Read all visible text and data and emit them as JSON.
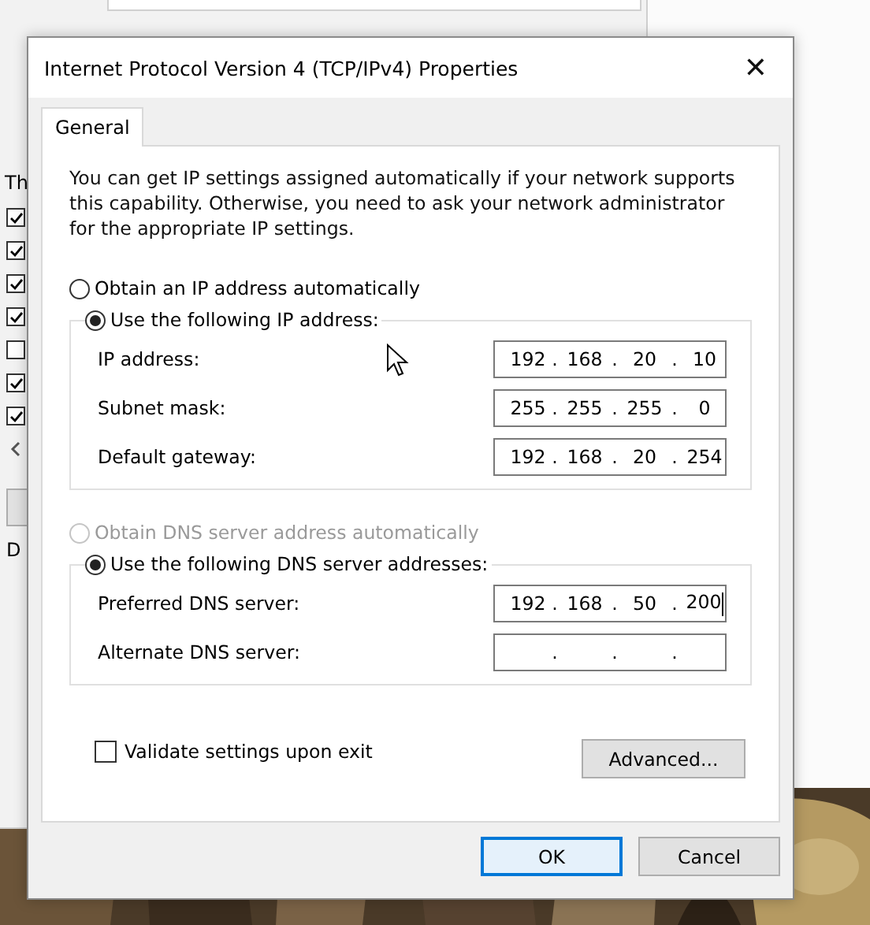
{
  "background_window": {
    "label": "Th",
    "label_2": "D",
    "items": [
      {
        "checked": true
      },
      {
        "checked": true
      },
      {
        "checked": true
      },
      {
        "checked": true
      },
      {
        "checked": false
      },
      {
        "checked": true
      },
      {
        "checked": true
      }
    ]
  },
  "window": {
    "title": "Internet Protocol Version 4 (TCP/IPv4) Properties",
    "close": "✕"
  },
  "tabs": [
    {
      "label": "General",
      "selected": true
    }
  ],
  "description": "You can get IP settings assigned automatically if your network supports this capability. Otherwise, you need to ask your network administrator for the appropriate IP settings.",
  "separator": ".",
  "ip_options": [
    {
      "label": "Obtain an IP address automatically",
      "selected": false,
      "disabled": false
    },
    {
      "label": "Use the following IP address:",
      "selected": true,
      "disabled": false
    }
  ],
  "ip_fields": [
    {
      "label": "IP address:",
      "octets": [
        "192",
        "168",
        "20",
        "10"
      ],
      "focused": false
    },
    {
      "label": "Subnet mask:",
      "octets": [
        "255",
        "255",
        "255",
        "0"
      ],
      "focused": false
    },
    {
      "label": "Default gateway:",
      "octets": [
        "192",
        "168",
        "20",
        "254"
      ],
      "focused": false
    }
  ],
  "dns_options": [
    {
      "label": "Obtain DNS server address automatically",
      "selected": false,
      "disabled": true
    },
    {
      "label": "Use the following DNS server addresses:",
      "selected": true,
      "disabled": false
    }
  ],
  "dns_fields": [
    {
      "label": "Preferred DNS server:",
      "octets": [
        "192",
        "168",
        "50",
        "200"
      ],
      "focused": true
    },
    {
      "label": "Alternate DNS server:",
      "focused": false
    }
  ],
  "validate": {
    "label": "Validate settings upon exit",
    "checked": false
  },
  "advanced_button": "Advanced...",
  "buttons": [
    {
      "label": "OK",
      "default": true
    },
    {
      "label": "Cancel",
      "default": false
    }
  ]
}
